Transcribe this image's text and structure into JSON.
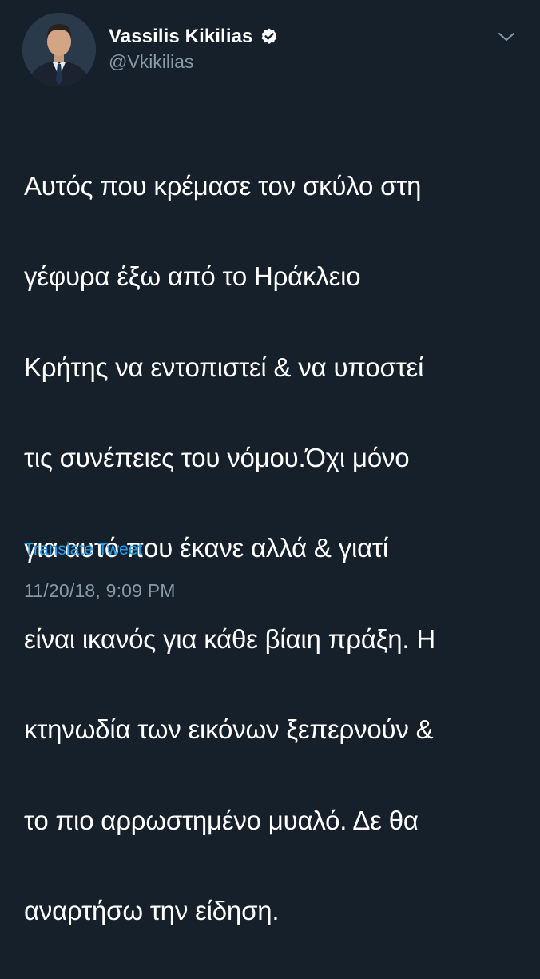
{
  "author": {
    "display_name": "Vassilis Kikilias",
    "handle": "@Vkikilias",
    "verified_icon": "verified-badge-icon",
    "avatar_icon": "profile-photo"
  },
  "menu_icon": "chevron-down-icon",
  "tweet": {
    "lines": [
      "Αυτός που κρέμασε τον σκύλο στη",
      "γέφυρα έξω από το Ηράκλειο",
      "Κρήτης να εντοπιστεί & να υποστεί",
      "τις συνέπειες του νόμου.Όχι μόνο",
      "για αυτό που έκανε αλλά & γιατί",
      "είναι ικανός για κάθε βίαιη πράξη. Η",
      "κτηνωδία των εικόνων ξεπερνούν &",
      "το πιο αρρωστημένο μυαλό. Δε θα",
      "αναρτήσω την είδηση."
    ],
    "translate_label": "Translate Tweet",
    "timestamp": "11/20/18, 9:09 PM"
  },
  "colors": {
    "background": "#15202b",
    "text": "#ffffff",
    "secondary_text": "#8899a6",
    "link": "#1da1f2"
  }
}
